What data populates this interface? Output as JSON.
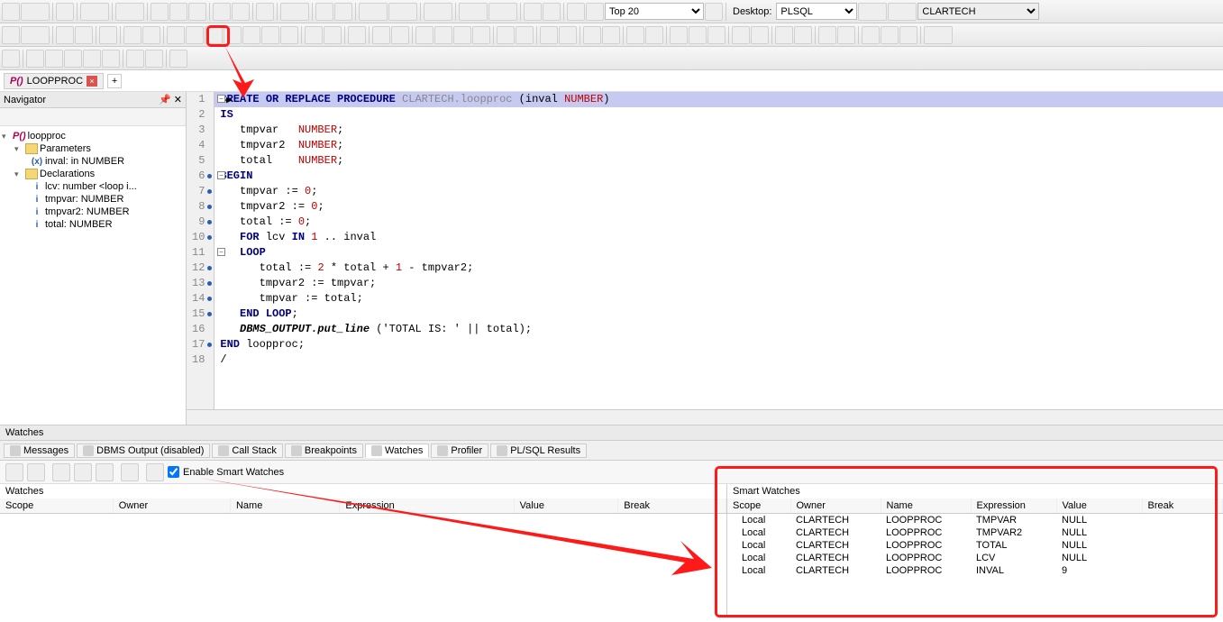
{
  "toolbar": {
    "top_label_top": "Top 20",
    "desktop_label": "Desktop:",
    "desktop_value": "PLSQL",
    "schema_box": "CLARTECH"
  },
  "tab": {
    "name": "LOOPPROC"
  },
  "navigator": {
    "title": "Navigator",
    "root": "loopproc",
    "folders": {
      "params": "Parameters",
      "decls": "Declarations"
    },
    "params_items": [
      "inval: in NUMBER"
    ],
    "decl_items": [
      "lcv: number <loop i...",
      "tmpvar: NUMBER",
      "tmpvar2: NUMBER",
      "total: NUMBER"
    ]
  },
  "code": {
    "lines": [
      {
        "n": 1,
        "hl": true,
        "cur": true,
        "fold": "-",
        "html": "<span class='kw'>CREATE OR REPLACE PROCEDURE</span> <span class='schema'>CLARTECH.loopproc</span> (inval <span class='type'>NUMBER</span>)"
      },
      {
        "n": 2,
        "html": "<span class='kw'>IS</span>"
      },
      {
        "n": 3,
        "html": "   tmpvar   <span class='type'>NUMBER</span>;"
      },
      {
        "n": 4,
        "html": "   tmpvar2  <span class='type'>NUMBER</span>;"
      },
      {
        "n": 5,
        "html": "   total    <span class='type'>NUMBER</span>;"
      },
      {
        "n": 6,
        "dot": true,
        "fold": "-",
        "html": "<span class='kw'>BEGIN</span>"
      },
      {
        "n": 7,
        "dot": true,
        "html": "   tmpvar := <span class='num'>0</span>;"
      },
      {
        "n": 8,
        "dot": true,
        "html": "   tmpvar2 := <span class='num'>0</span>;"
      },
      {
        "n": 9,
        "dot": true,
        "html": "   total := <span class='num'>0</span>;"
      },
      {
        "n": 10,
        "dot": true,
        "html": "   <span class='kw'>FOR</span> lcv <span class='kw'>IN</span> <span class='num'>1</span> .. inval"
      },
      {
        "n": 11,
        "fold": "-",
        "html": "   <span class='kw'>LOOP</span>"
      },
      {
        "n": 12,
        "dot": true,
        "html": "      total := <span class='num'>2</span> * total + <span class='num'>1</span> - tmpvar2;"
      },
      {
        "n": 13,
        "dot": true,
        "html": "      tmpvar2 := tmpvar;"
      },
      {
        "n": 14,
        "dot": true,
        "html": "      tmpvar := total;"
      },
      {
        "n": 15,
        "dot": true,
        "html": "   <span class='kw'>END LOOP</span>;"
      },
      {
        "n": 16,
        "html": "   <span class='func'>DBMS_OUTPUT.put_line</span> (<span class='str'>'TOTAL IS: '</span> || total);"
      },
      {
        "n": 17,
        "dot": true,
        "html": "<span class='kw'>END</span> loopproc;"
      },
      {
        "n": 18,
        "html": "/"
      }
    ]
  },
  "watches_header": "Watches",
  "bottom_tabs": {
    "messages": "Messages",
    "dbms": "DBMS Output (disabled)",
    "callstack": "Call Stack",
    "breakpoints": "Breakpoints",
    "watches": "Watches",
    "profiler": "Profiler",
    "plsql": "PL/SQL Results"
  },
  "enable_smart": "Enable Smart Watches",
  "grid_left_title": "Watches",
  "grid_right_title": "Smart Watches",
  "columns": {
    "scope": "Scope",
    "owner": "Owner",
    "name": "Name",
    "expression": "Expression",
    "value": "Value",
    "break": "Break"
  },
  "smart_rows": [
    {
      "scope": "Local",
      "owner": "CLARTECH",
      "name": "LOOPPROC",
      "expr": "TMPVAR",
      "value": "NULL"
    },
    {
      "scope": "Local",
      "owner": "CLARTECH",
      "name": "LOOPPROC",
      "expr": "TMPVAR2",
      "value": "NULL"
    },
    {
      "scope": "Local",
      "owner": "CLARTECH",
      "name": "LOOPPROC",
      "expr": "TOTAL",
      "value": "NULL"
    },
    {
      "scope": "Local",
      "owner": "CLARTECH",
      "name": "LOOPPROC",
      "expr": "LCV",
      "value": "NULL"
    },
    {
      "scope": "Local",
      "owner": "CLARTECH",
      "name": "LOOPPROC",
      "expr": "INVAL",
      "value": "9"
    }
  ]
}
